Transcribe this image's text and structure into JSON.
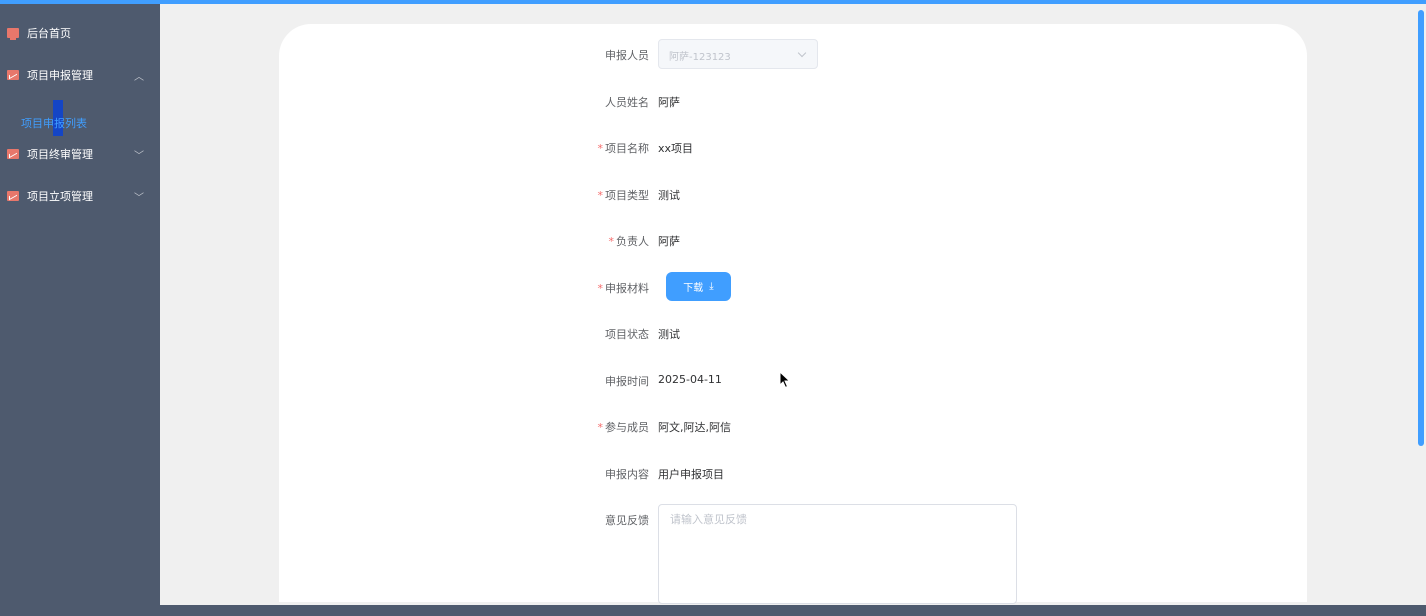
{
  "sidebar": {
    "items": [
      {
        "label": "后台首页",
        "icon": "monitor-icon"
      },
      {
        "label": "项目申报管理",
        "icon": "chart-icon",
        "expanded": true
      },
      {
        "label": "项目终审管理",
        "icon": "chart-icon"
      },
      {
        "label": "项目立项管理",
        "icon": "chart-icon"
      }
    ],
    "subitem": "项目申报列表"
  },
  "form": {
    "applicant": {
      "label": "申报人员",
      "value": "阿萨-123123"
    },
    "name": {
      "label": "人员姓名",
      "value": "阿萨"
    },
    "project_name": {
      "label": "项目名称",
      "value": "xx项目"
    },
    "project_type": {
      "label": "项目类型",
      "value": "测试"
    },
    "leader": {
      "label": "负责人",
      "value": "阿萨"
    },
    "materials": {
      "label": "申报材料",
      "button": "下载"
    },
    "status": {
      "label": "项目状态",
      "value": "测试"
    },
    "time": {
      "label": "申报时间",
      "value": "2025-04-11"
    },
    "members": {
      "label": "参与成员",
      "value": "阿文,阿达,阿信"
    },
    "content": {
      "label": "申报内容",
      "value": "用户申报项目"
    },
    "feedback": {
      "label": "意见反馈",
      "placeholder": "请输入意见反馈"
    }
  },
  "required_marker": "*",
  "colors": {
    "accent": "#409eff",
    "sidebar": "#4e5a6e",
    "required": "#f56c6c"
  }
}
